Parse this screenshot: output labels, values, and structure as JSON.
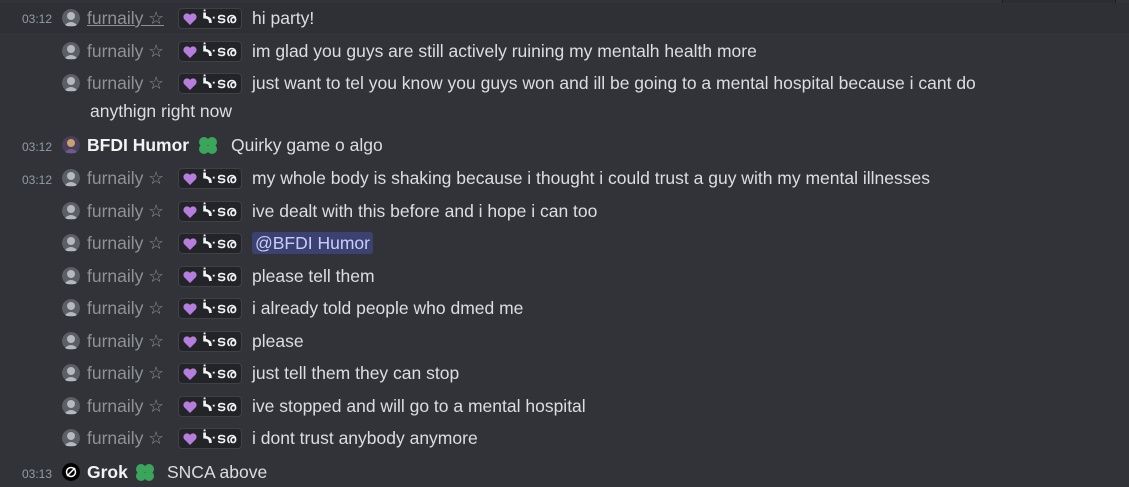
{
  "user_fur": {
    "name": "furnaily ☆",
    "tag": "ᔃടര"
  },
  "messages": [
    {
      "time": "03:12",
      "text": "hi party!"
    },
    {
      "text": "im glad you guys are still actively ruining my mentalh health more"
    },
    {
      "text": "just want to tel you know you guys won and ill be going to a mental hospital because i cant do",
      "cont": "anythign right now"
    },
    {
      "time": "03:12",
      "name": "BFDI Humor",
      "text": "Quirky game o algo"
    },
    {
      "time": "03:12",
      "text": "my whole body is shaking because i thought i could trust a guy with my mental illnesses"
    },
    {
      "text": "ive dealt with this before and i hope i can too"
    },
    {
      "mention": "@BFDI Humor"
    },
    {
      "text": "please tell them"
    },
    {
      "text": "i already told people who dmed me"
    },
    {
      "text": "please"
    },
    {
      "text": "just tell them they can stop"
    },
    {
      "text": "ive stopped and will go to a mental hospital"
    },
    {
      "text": "i dont trust anybody anymore"
    },
    {
      "time": "03:13",
      "name": "Grok",
      "text": "SNCA above"
    }
  ],
  "colors": {
    "background": "#313338",
    "muted": "#949ba4",
    "badge_green": "#3ba55c",
    "mention_bg": "#3c4270"
  }
}
